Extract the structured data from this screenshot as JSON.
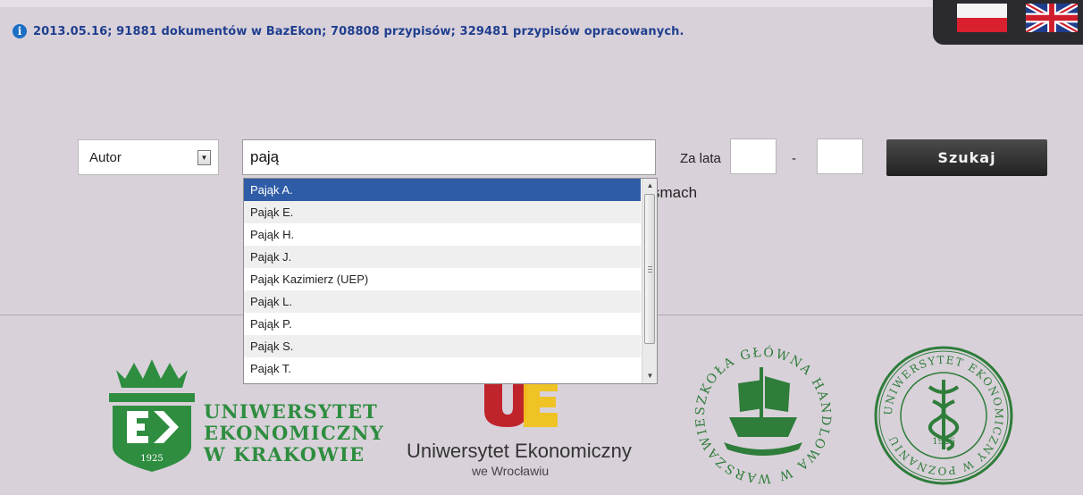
{
  "info": {
    "text": "2013.05.16; 91881 dokumentów w BazEkon; 708808 przypisów; 329481 przypisów opracowanych.",
    "icon": "info-icon"
  },
  "language": {
    "flags": [
      "polish-flag-icon",
      "uk-flag-icon"
    ]
  },
  "search": {
    "field_select": "Autor",
    "query": "pają",
    "years_label": "Za lata",
    "year_from": "",
    "year_to": "",
    "year_separator": "-",
    "button": "Szukaj",
    "partially_hidden_text": "smach"
  },
  "autocomplete": {
    "items": [
      "Pająk A.",
      "Pająk E.",
      "Pająk H.",
      "Pająk J.",
      "Pająk Kazimierz (UEP)",
      "Pająk L.",
      "Pająk P.",
      "Pająk S.",
      "Pająk T."
    ],
    "selected_index": 0
  },
  "logos": {
    "uek": {
      "line1": "UNIWERSYTET",
      "line2": "EKONOMICZNY",
      "line3": "W KRAKOWIE",
      "year": "1925"
    },
    "ue_wroclaw": {
      "name": "Uniwersytet Ekonomiczny",
      "city": "we Wrocławiu"
    },
    "sgh": {
      "ring": "SZKOŁA GŁÓWNA HANDLOWA W WARSZAWIE"
    },
    "uep": {
      "ring": "UNIWERSYTET EKONOMICZNY W POZNANIU",
      "year": "1926"
    }
  },
  "colors": {
    "background": "#d9d1da",
    "info_text": "#1f3f8f",
    "selection": "#2f5ca6",
    "uek_green": "#2e8d3f",
    "ue_red": "#c0242b",
    "ue_yellow": "#f1c21b",
    "seal_green": "#2e7d3a"
  }
}
